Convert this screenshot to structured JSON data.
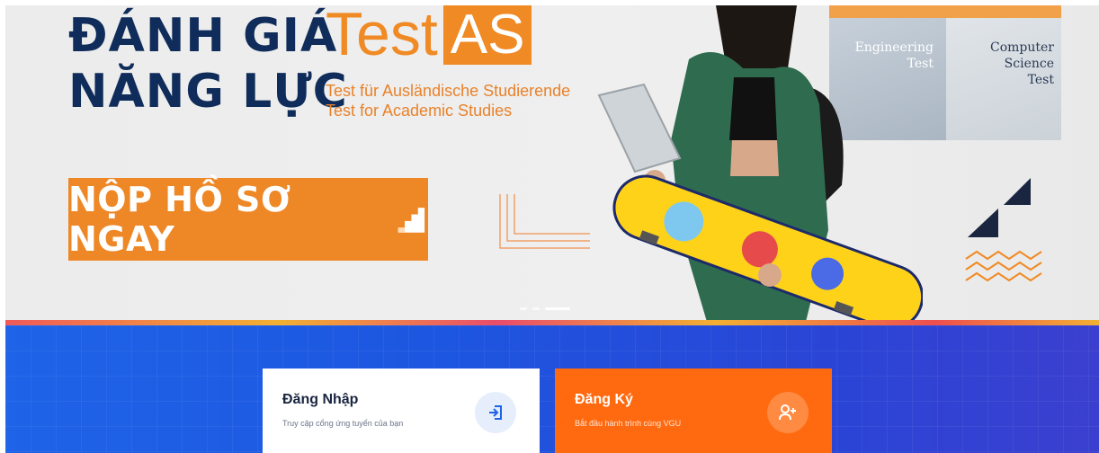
{
  "hero": {
    "title_line1": "ĐÁNH GIÁ",
    "title_line2": "NĂNG LỰC",
    "brand_test": "Test",
    "brand_as": "AS",
    "subtitle_de": "Test für Ausländische Studierende",
    "subtitle_en": "Test for Academic Studies",
    "cta_label": "NỘP HỒ SƠ NGAY",
    "panel_engineering": [
      "Engineering",
      "Test"
    ],
    "panel_cs": [
      "Computer",
      "Science",
      "Test"
    ],
    "slides": 3,
    "active_slide": 3
  },
  "cards": {
    "login": {
      "title": "Đăng Nhập",
      "description": "Truy cập cổng ứng tuyển của bạn",
      "icon": "login-icon"
    },
    "register": {
      "title": "Đăng Ký",
      "description": "Bắt đầu hành trình cùng VGU",
      "icon": "add-user-icon"
    }
  },
  "colors": {
    "brand_orange": "#EE8726",
    "navy": "#0F2C5A",
    "blue_section": "#1E63E8",
    "register_orange": "#FF6A10"
  }
}
